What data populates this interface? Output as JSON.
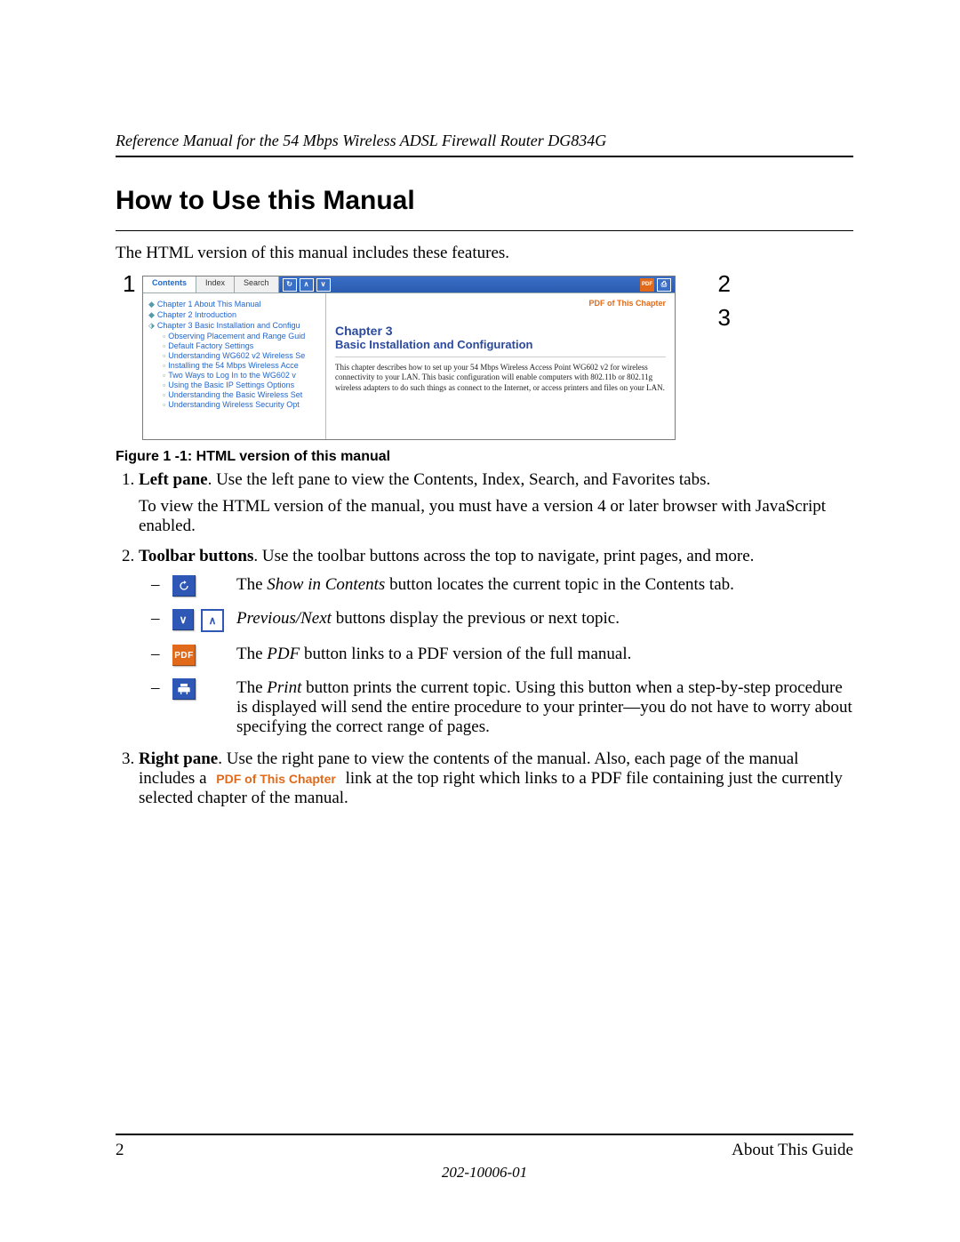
{
  "header": {
    "running_title": "Reference Manual for the 54 Mbps Wireless ADSL Firewall Router DG834G"
  },
  "title": "How to Use this Manual",
  "intro": "The HTML version of this manual includes these features.",
  "callouts": {
    "one": "1",
    "two": "2",
    "three": "3"
  },
  "screenshot": {
    "tabs": {
      "contents": "Contents",
      "index": "Index",
      "search": "Search"
    },
    "toolbar_icons": {
      "show_in_contents": "↻",
      "prev": "∧",
      "next": "∨",
      "pdf": "PDF",
      "print": "⎙"
    },
    "toc": {
      "chap1": "Chapter 1 About This Manual",
      "chap2": "Chapter 2 Introduction",
      "chap3": "Chapter 3 Basic Installation and Configu",
      "sub": {
        "a": "Observing Placement and Range Guid",
        "b": "Default Factory Settings",
        "c": "Understanding WG602 v2 Wireless Se",
        "d": "Installing the 54 Mbps Wireless Acce",
        "e": "Two Ways to Log In to the WG602 v",
        "f": "Using the Basic IP Settings Options",
        "g": "Understanding the Basic Wireless Set",
        "h": "Understanding Wireless Security Opt"
      }
    },
    "right": {
      "pdf_link": "PDF of This Chapter",
      "h1": "Chapter 3",
      "h2": "Basic Installation and Configuration",
      "body": "This chapter describes how to set up your 54 Mbps Wireless Access Point WG602 v2 for wireless connectivity to your LAN. This basic configuration will enable computers with 802.11b or 802.11g wireless adapters to do such things as connect to the Internet, or access printers and files on your LAN."
    }
  },
  "figure_caption": "Figure 1 -1:  HTML version of this manual",
  "items": {
    "left_pane": {
      "lead": "Left pane",
      "rest": ". Use the left pane to view the Contents, Index, Search, and Favorites tabs.",
      "note": "To view the HTML version of the manual, you must have a version 4 or later browser with JavaScript enabled."
    },
    "toolbar": {
      "lead": "Toolbar buttons",
      "rest": ". Use the toolbar buttons across the top to navigate, print pages, and more.",
      "show_in_contents": {
        "pre": "The ",
        "em": "Show in Contents",
        "post": " button locates the current topic in the Contents tab."
      },
      "prev_next": {
        "em": "Previous/Next",
        "post": " buttons display the previous or next topic."
      },
      "pdf": {
        "pre": "The ",
        "em": "PDF",
        "post": " button links to a PDF version of the full manual."
      },
      "print": {
        "pre": "The ",
        "em": "Print",
        "post": " button prints the current topic. Using this button when a step-by-step procedure is displayed will send the entire procedure to your printer—you do not have to worry about specifying the correct range of pages."
      }
    },
    "right_pane": {
      "lead": "Right pane",
      "pre": ". Use the right pane to view the contents of the manual. Also, each page of the manual includes a ",
      "link_label": "PDF of This Chapter",
      "post": " link at the top right which links to a PDF file containing just the currently selected chapter of the manual."
    }
  },
  "footer": {
    "page_number": "2",
    "section": "About This Guide",
    "doc_number": "202-10006-01"
  }
}
